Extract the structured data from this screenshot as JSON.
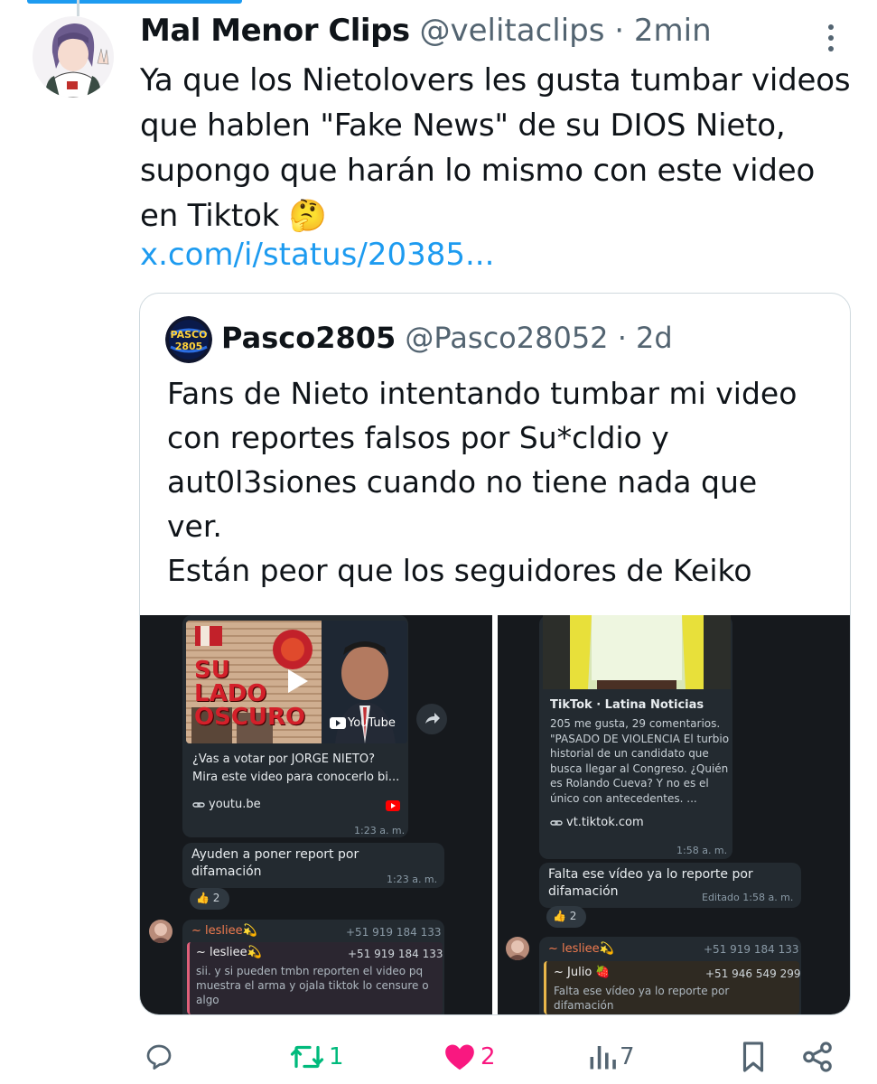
{
  "tweet": {
    "name": "Mal Menor Clips",
    "handle": "@velitaclips",
    "separator": "·",
    "time": "2min",
    "text_lines": [
      "Ya que los Nietolovers les gusta tumbar videos",
      "que hablen \"Fake News\" de su DIOS Nieto,",
      "supongo que harán lo mismo con este video",
      "en Tiktok"
    ],
    "emoji": "🤔",
    "link": "x.com/i/status/20385..."
  },
  "quote": {
    "name": "Pasco2805",
    "handle": "@Pasco28052",
    "separator": "·",
    "time": "2d",
    "avatar_text": "PASCO 2805",
    "text_lines": [
      "Fans de Nieto intentando tumbar mi video",
      "con reportes falsos por Su*cldio y",
      "aut0l3siones cuando no tiene nada que",
      "ver.",
      "Están peor que los seguidores de Keiko"
    ]
  },
  "left_shot": {
    "thumb_title": "SU LADO OSCURO",
    "youtube_label": "YouTube",
    "card_title": "¿Vas a votar por JORGE NIETO?",
    "card_desc": "Mira este video para conocerlo bi...",
    "domain": "youtu.be",
    "time1": "1:23 a. m.",
    "msg2": "Ayuden a poner report por difamación",
    "time2": "1:23 a. m.",
    "reaction": "👍 2",
    "reply_name": "~ lesliee💫",
    "reply_phone": "+51 919 184 133",
    "quoted_name": "~ lesliee💫",
    "quoted_phone": "+51 919 184 133",
    "quoted_text": "sii. y si pueden tmbn reporten el video pq muestra el arma y ojala tiktok lo censure o algo"
  },
  "right_shot": {
    "source": "TikTok · Latina Noticias",
    "desc": "205 me gusta, 29 comentarios. \"PASADO DE VIOLENCIA El turbio historial de un candidato que busca llegar al Congreso. ¿Quién es Rolando Cueva? Y no es el único con antecedentes. ...",
    "domain": "vt.tiktok.com",
    "time1": "1:58 a. m.",
    "msg2": "Falta ese vídeo ya lo reporte por difamación",
    "edited": "Editado 1:58 a. m.",
    "reaction": "👍 2",
    "reply_name": "~ lesliee💫",
    "reply_phone": "+51 919 184 133",
    "quoted_name": "~ Julio 🍓",
    "quoted_phone": "+51 946 549 299",
    "quoted_text": "Falta ese vídeo ya lo reporte por difamación"
  },
  "actions": {
    "reposts": "1",
    "likes": "2",
    "views": "7"
  },
  "colors": {
    "link": "#1d9bf0",
    "repost": "#00ba7c",
    "like": "#f91880",
    "muted": "#536471"
  }
}
